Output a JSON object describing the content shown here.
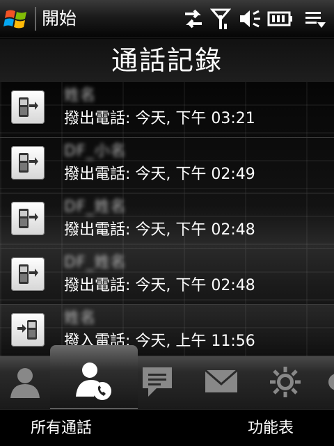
{
  "status_bar": {
    "start_label": "開始",
    "icons": [
      "windows-logo-icon",
      "data-sync-icon",
      "signal-icon",
      "volume-icon",
      "battery-icon",
      "menu-icon"
    ]
  },
  "page": {
    "title": "通話記錄"
  },
  "calls": [
    {
      "name": "姓名",
      "detail": "撥出電話: 今天, 下午 03:21",
      "type": "outgoing"
    },
    {
      "name": "DF_小名",
      "detail": "撥出電話: 今天, 下午 02:49",
      "type": "outgoing"
    },
    {
      "name": "DF_姓名",
      "detail": "撥出電話: 今天, 下午 02:48",
      "type": "outgoing"
    },
    {
      "name": "DF_姓名",
      "detail": "撥出電話: 今天, 下午 02:48",
      "type": "outgoing"
    },
    {
      "name": "姓名",
      "detail": "撥入電話: 今天, 上午 11:56",
      "type": "incoming"
    }
  ],
  "tabs": [
    {
      "icon": "contact-person-icon",
      "active": false
    },
    {
      "icon": "phone-call-person-icon",
      "active": true
    },
    {
      "icon": "message-bubble-icon",
      "active": false
    },
    {
      "icon": "mail-envelope-icon",
      "active": false
    },
    {
      "icon": "settings-gear-icon",
      "active": false
    }
  ],
  "softkeys": {
    "left": "所有通話",
    "right": "功能表"
  },
  "colors": {
    "background": "#000000",
    "text": "#ffffff",
    "row_divider": "#3c3c3c"
  }
}
